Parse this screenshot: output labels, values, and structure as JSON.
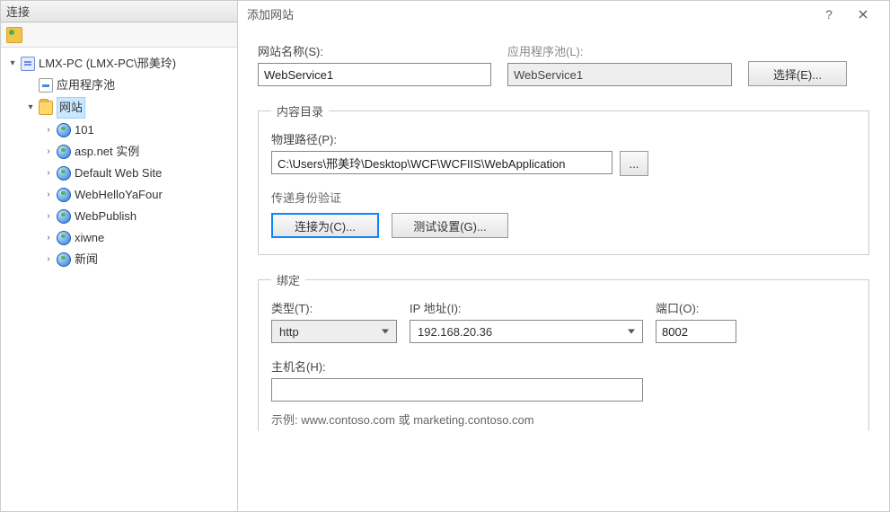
{
  "connections": {
    "header": "连接",
    "root": "LMX-PC (LMX-PC\\邢美玲)",
    "apppool": "应用程序池",
    "sites_label": "网站",
    "sites": [
      "101",
      "asp.net 实例",
      "Default Web Site",
      "WebHelloYaFour",
      "WebPublish",
      "xiwne",
      "新闻"
    ]
  },
  "dialog": {
    "title": "添加网站",
    "sitename_label": "网站名称(S):",
    "sitename_value": "WebService1",
    "apppool_label": "应用程序池(L):",
    "apppool_value": "WebService1",
    "select_btn": "选择(E)...",
    "content_legend": "内容目录",
    "phys_label": "物理路径(P):",
    "phys_value": "C:\\Users\\邢美玲\\Desktop\\WCF\\WCFIIS\\WebApplication",
    "browse_btn": "...",
    "passthrough_label": "传递身份验证",
    "connect_as_btn": "连接为(C)...",
    "test_btn": "测试设置(G)...",
    "binding_legend": "绑定",
    "type_label": "类型(T):",
    "type_value": "http",
    "ip_label": "IP 地址(I):",
    "ip_value": "192.168.20.36",
    "port_label": "端口(O):",
    "port_value": "8002",
    "hostname_label": "主机名(H):",
    "hostname_value": "",
    "example_text": "示例: www.contoso.com 或 marketing.contoso.com"
  }
}
